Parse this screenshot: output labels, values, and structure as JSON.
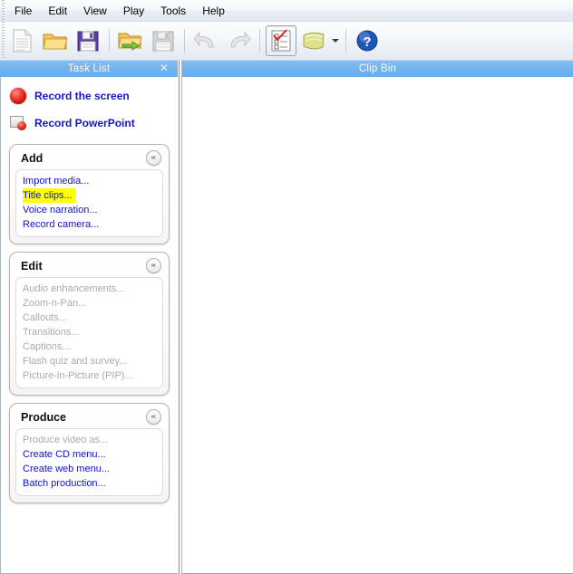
{
  "menubar": {
    "items": [
      {
        "label": "File"
      },
      {
        "label": "Edit"
      },
      {
        "label": "View"
      },
      {
        "label": "Play"
      },
      {
        "label": "Tools"
      },
      {
        "label": "Help"
      }
    ]
  },
  "toolbar": {
    "buttons": [
      {
        "name": "new-icon",
        "tooltip": "New",
        "enabled": false
      },
      {
        "name": "open-folder-icon",
        "tooltip": "Open",
        "enabled": true
      },
      {
        "name": "save-floppy-icon",
        "tooltip": "Save",
        "enabled": true
      },
      {
        "name": "import-media-icon",
        "tooltip": "Import media",
        "enabled": true
      },
      {
        "name": "save-as-icon",
        "tooltip": "Save as",
        "enabled": false
      },
      {
        "name": "undo-icon",
        "tooltip": "Undo",
        "enabled": false
      },
      {
        "name": "redo-icon",
        "tooltip": "Redo",
        "enabled": false
      },
      {
        "name": "task-list-icon",
        "tooltip": "Task List",
        "enabled": true,
        "pressed": true
      },
      {
        "name": "clip-bin-icon",
        "tooltip": "Clip Bin",
        "enabled": true
      },
      {
        "name": "help-icon",
        "tooltip": "Help",
        "enabled": true
      }
    ]
  },
  "task_list": {
    "header_title": "Task List",
    "close_label": "✕",
    "record_actions": [
      {
        "label": "Record the screen",
        "icon": "record-screen-icon"
      },
      {
        "label": "Record PowerPoint",
        "icon": "record-powerpoint-icon"
      }
    ],
    "groups": [
      {
        "title": "Add",
        "collapse_glyph": "«",
        "items": [
          {
            "label": "Import media...",
            "enabled": true,
            "highlighted": false
          },
          {
            "label": "Title clips...",
            "enabled": true,
            "highlighted": true
          },
          {
            "label": "Voice narration...",
            "enabled": true,
            "highlighted": false
          },
          {
            "label": "Record camera...",
            "enabled": true,
            "highlighted": false
          }
        ]
      },
      {
        "title": "Edit",
        "collapse_glyph": "«",
        "items": [
          {
            "label": "Audio enhancements...",
            "enabled": false,
            "highlighted": false
          },
          {
            "label": "Zoom-n-Pan...",
            "enabled": false,
            "highlighted": false
          },
          {
            "label": "Callouts...",
            "enabled": false,
            "highlighted": false
          },
          {
            "label": "Transitions...",
            "enabled": false,
            "highlighted": false
          },
          {
            "label": "Captions...",
            "enabled": false,
            "highlighted": false
          },
          {
            "label": "Flash quiz and survey...",
            "enabled": false,
            "highlighted": false
          },
          {
            "label": "Picture-in-Picture (PIP)...",
            "enabled": false,
            "highlighted": false
          }
        ]
      },
      {
        "title": "Produce",
        "collapse_glyph": "«",
        "items": [
          {
            "label": "Produce video as...",
            "enabled": false,
            "highlighted": false
          },
          {
            "label": "Create CD menu...",
            "enabled": true,
            "highlighted": false
          },
          {
            "label": "Create web menu...",
            "enabled": true,
            "highlighted": false
          },
          {
            "label": "Batch production...",
            "enabled": true,
            "highlighted": false
          }
        ]
      }
    ]
  },
  "clip_bin": {
    "header_title": "Clip Bin",
    "content": ""
  },
  "colors": {
    "pane_header_blue": "#73b3ee",
    "link_blue": "#1111cc",
    "disabled_gray": "#aaaaaa",
    "highlight_yellow": "#ffff00",
    "record_red": "#e52015"
  }
}
